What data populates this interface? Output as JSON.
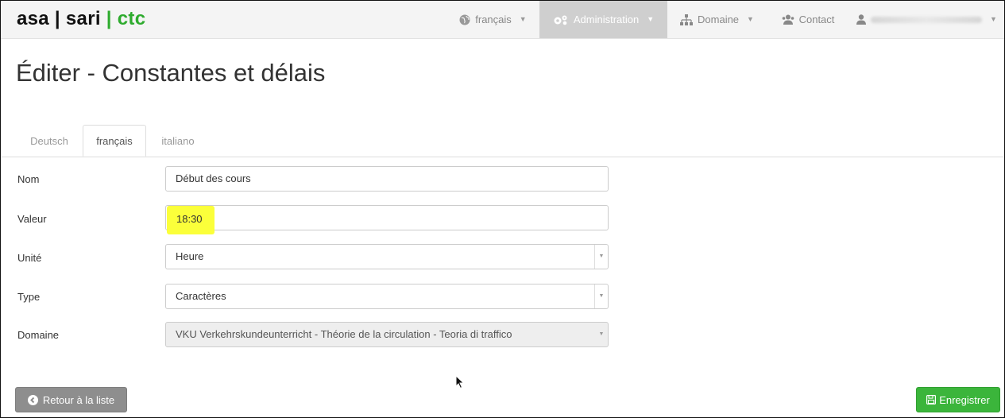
{
  "brand": {
    "part1": "asa",
    "sep1": " | ",
    "part2": "sari",
    "sep2": " | ",
    "part3": "ctc"
  },
  "nav": {
    "language": "français",
    "administration": "Administration",
    "domain": "Domaine",
    "contact": "Contact"
  },
  "page": {
    "title": "Éditer - Constantes et délais"
  },
  "tabs": [
    {
      "label": "Deutsch",
      "active": false
    },
    {
      "label": "français",
      "active": true
    },
    {
      "label": "italiano",
      "active": false
    }
  ],
  "form": {
    "nom_label": "Nom",
    "nom_value": "Début des cours",
    "valeur_label": "Valeur",
    "valeur_value": "18:30",
    "unite_label": "Unité",
    "unite_value": "Heure",
    "type_label": "Type",
    "type_value": "Caractères",
    "domaine_label": "Domaine",
    "domaine_value": "VKU Verkehrskundeunterricht - Théorie de la circulation - Teoria di traffico"
  },
  "buttons": {
    "back": "Retour à la liste",
    "save": "Enregistrer"
  },
  "colors": {
    "brand_green": "#2eab2e",
    "highlight": "#fbff3a",
    "save_green": "#3bb53b",
    "back_gray": "#8e8e8e"
  }
}
